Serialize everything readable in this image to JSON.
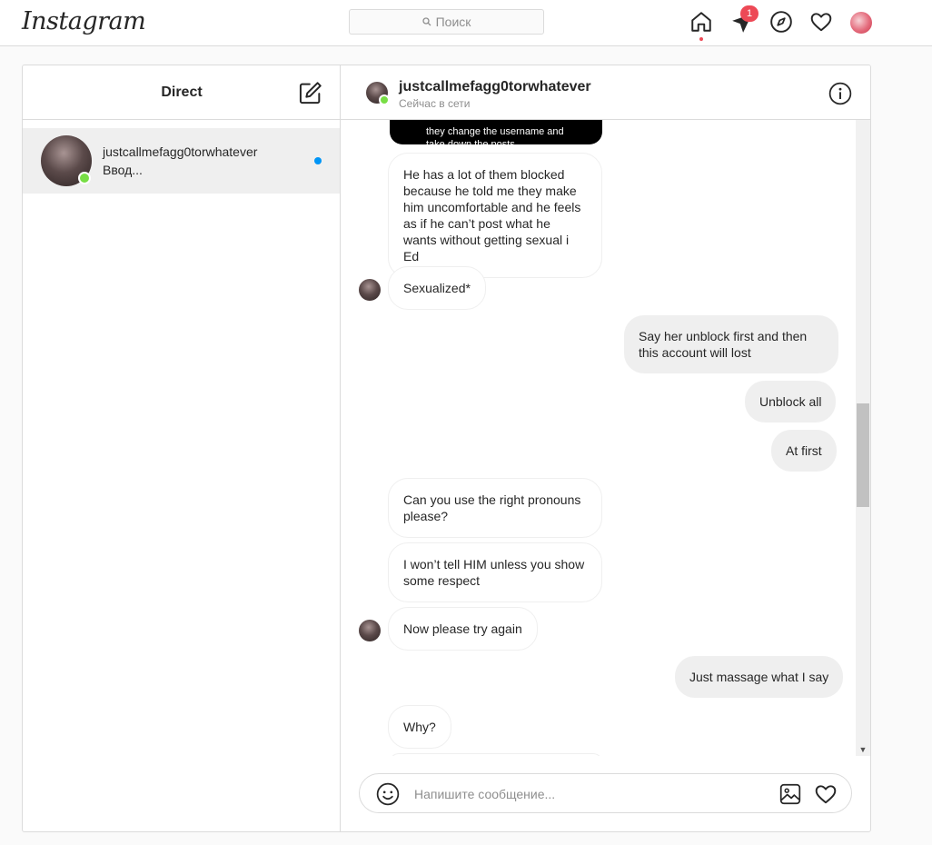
{
  "app": {
    "brand": "Instagram"
  },
  "topnav": {
    "search_placeholder": "Поиск",
    "direct_badge": "1",
    "icons": [
      "home-icon",
      "direct-icon",
      "explore-icon",
      "activity-heart-icon",
      "profile-avatar"
    ]
  },
  "sidebar": {
    "title": "Direct",
    "conversations": [
      {
        "name": "justcallmefagg0torwhatever",
        "preview": "Ввод...",
        "online": true,
        "unread": true
      }
    ]
  },
  "chat": {
    "username": "justcallmefagg0torwhatever",
    "status": "Сейчас в сети",
    "image_caption": "they change the username and\ntake down the posts",
    "messages": [
      {
        "from": "them",
        "text": "He has a lot of them blocked because he told me they make him uncomfortable and he feels as if he can’t post what he wants without getting sexual i Ed"
      },
      {
        "from": "them",
        "text": "Sexualized*"
      },
      {
        "from": "me",
        "text": "Say her unblock first and then this account will lost"
      },
      {
        "from": "me",
        "text": "Unblock all"
      },
      {
        "from": "me",
        "text": "At first"
      },
      {
        "from": "them",
        "text": "Can you use the right pronouns please?"
      },
      {
        "from": "them",
        "text": "I won’t tell HIM unless you show some respect"
      },
      {
        "from": "them",
        "text": "Now please try again"
      },
      {
        "from": "me",
        "text": "Just massage what I say"
      },
      {
        "from": "them",
        "text": "Why?"
      }
    ],
    "composer_placeholder": "Напишите сообщение..."
  },
  "colors": {
    "accent_blue": "#0095f6",
    "badge_red": "#ed4956",
    "online_green": "#78de45",
    "border": "#dbdbdb",
    "bubble_out": "#efefef"
  }
}
